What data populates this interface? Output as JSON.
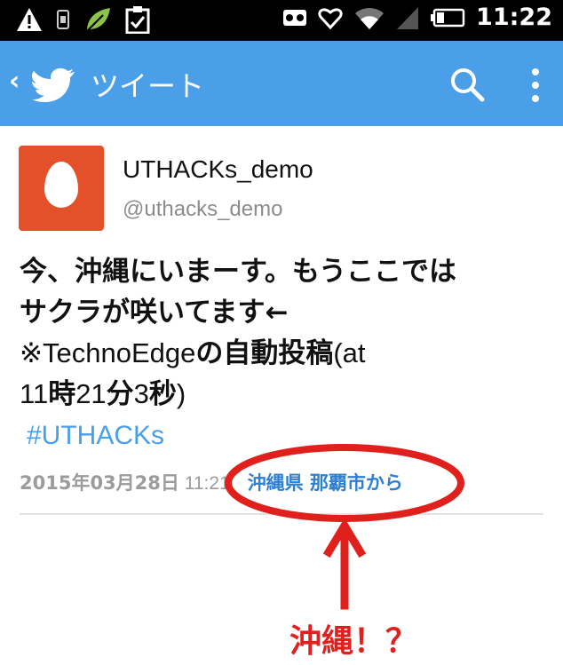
{
  "status_bar": {
    "time": "11:22",
    "icons_left": [
      "warning-icon",
      "vibrate-icon",
      "leaf-icon",
      "clipboard-icon"
    ],
    "icons_right": [
      "voicemail-icon",
      "heart-icon",
      "wifi-icon",
      "signal-icon",
      "battery-icon"
    ]
  },
  "app_bar": {
    "back": "‹",
    "title": "ツイート",
    "actions": [
      "search-icon",
      "overflow-menu-icon"
    ],
    "background": "#4a9fe8"
  },
  "tweet": {
    "display_name": "UTHACKs_demo",
    "handle": "@uthacks_demo",
    "avatar_color": "#e4502a",
    "line1": "今、沖縄にいまーす。もうここでは",
    "line2": "サクラが咲いてます←",
    "line3_prefix": "※",
    "line3_app": "TechnoEdge",
    "line3_mid": "の自動投稿",
    "line3_open": "(at",
    "line4_a": "11",
    "line4_b": "時",
    "line4_c": "21",
    "line4_d": "分",
    "line4_e": "3",
    "line4_f": "秒",
    "line4_g": ")",
    "hashtag": "#UTHACKs",
    "date": "2015年03月28日",
    "time": "11:21",
    "location": "沖縄県 那覇市から"
  },
  "annotation": {
    "text": "沖縄！？",
    "color": "#e0201c"
  }
}
